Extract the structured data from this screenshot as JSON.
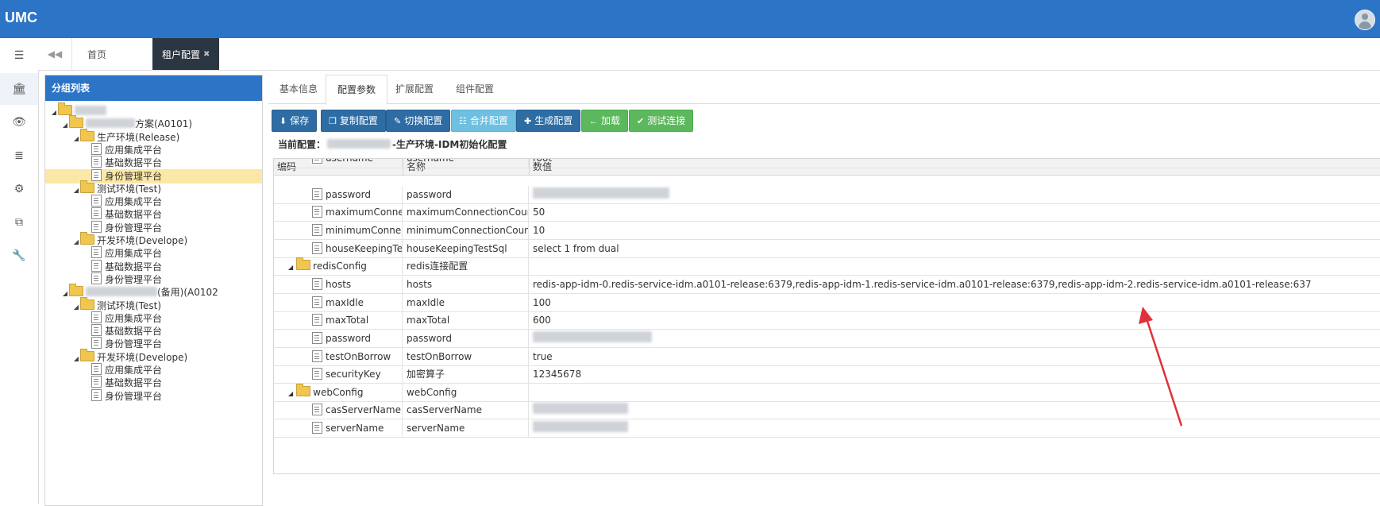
{
  "app": {
    "brand": "UMC"
  },
  "rail": {
    "items": [
      {
        "name": "rail-toggle-icon",
        "glyph": "☰"
      },
      {
        "name": "bank-icon",
        "glyph": "🏛"
      },
      {
        "name": "eye-icon",
        "glyph": "👁"
      },
      {
        "name": "list-icon",
        "glyph": "≣"
      },
      {
        "name": "gear-icon",
        "glyph": "⚙"
      },
      {
        "name": "sitemap-icon",
        "glyph": "⧉"
      },
      {
        "name": "wrench-icon",
        "glyph": "🔧"
      }
    ]
  },
  "tabstrip": {
    "nav_glyph": "◀◀",
    "home_label": "首页",
    "active_label": "租户配置",
    "close_glyph": "✖"
  },
  "group_panel": {
    "title": "分组列表",
    "tree": [
      {
        "depth": 0,
        "kind": "folder",
        "expanded": true,
        "label": "",
        "blurred": true,
        "blur_width": 40
      },
      {
        "depth": 1,
        "kind": "folder",
        "expanded": true,
        "label": "方案(A0101)",
        "blurred": true,
        "blur_width": 62
      },
      {
        "depth": 2,
        "kind": "folder",
        "expanded": true,
        "label": "生产环境(Release)"
      },
      {
        "depth": 3,
        "kind": "file",
        "label": "应用集成平台"
      },
      {
        "depth": 3,
        "kind": "file",
        "label": "基础数据平台"
      },
      {
        "depth": 3,
        "kind": "file",
        "label": "身份管理平台",
        "selected": true
      },
      {
        "depth": 2,
        "kind": "folder",
        "expanded": true,
        "label": "测试环境(Test)"
      },
      {
        "depth": 3,
        "kind": "file",
        "label": "应用集成平台"
      },
      {
        "depth": 3,
        "kind": "file",
        "label": "基础数据平台"
      },
      {
        "depth": 3,
        "kind": "file",
        "label": "身份管理平台"
      },
      {
        "depth": 2,
        "kind": "folder",
        "expanded": true,
        "label": "开发环境(Develope)"
      },
      {
        "depth": 3,
        "kind": "file",
        "label": "应用集成平台"
      },
      {
        "depth": 3,
        "kind": "file",
        "label": "基础数据平台"
      },
      {
        "depth": 3,
        "kind": "file",
        "label": "身份管理平台"
      },
      {
        "depth": 1,
        "kind": "folder",
        "expanded": true,
        "label": "(备用)(A0102",
        "blurred": true,
        "blur_width": 90
      },
      {
        "depth": 2,
        "kind": "folder",
        "expanded": true,
        "label": "测试环境(Test)"
      },
      {
        "depth": 3,
        "kind": "file",
        "label": "应用集成平台"
      },
      {
        "depth": 3,
        "kind": "file",
        "label": "基础数据平台"
      },
      {
        "depth": 3,
        "kind": "file",
        "label": "身份管理平台"
      },
      {
        "depth": 2,
        "kind": "folder",
        "expanded": true,
        "label": "开发环境(Develope)"
      },
      {
        "depth": 3,
        "kind": "file",
        "label": "应用集成平台"
      },
      {
        "depth": 3,
        "kind": "file",
        "label": "基础数据平台"
      },
      {
        "depth": 3,
        "kind": "file",
        "label": "身份管理平台"
      }
    ]
  },
  "content": {
    "tabs": [
      {
        "label": "基本信息",
        "active": false
      },
      {
        "label": "配置参数",
        "active": true
      },
      {
        "label": "扩展配置",
        "active": false
      },
      {
        "label": "组件配置",
        "active": false
      }
    ],
    "toolbar": [
      {
        "name": "save-button",
        "label": "保存",
        "icon": "⬇",
        "style": "blue"
      },
      {
        "name": "copy-config-button",
        "label": "复制配置",
        "icon": "❐",
        "style": "blue"
      },
      {
        "name": "switch-config-button",
        "label": "切换配置",
        "icon": "✎",
        "style": "blue"
      },
      {
        "name": "merge-config-button",
        "label": "合并配置",
        "icon": "☷",
        "style": "lightblue"
      },
      {
        "name": "generate-config-button",
        "label": "生成配置",
        "icon": "✚",
        "style": "blue"
      },
      {
        "name": "load-button",
        "label": "加载",
        "icon": "←",
        "style": "green"
      },
      {
        "name": "test-connection-button",
        "label": "测试连接",
        "icon": "✔",
        "style": "green"
      }
    ],
    "current_config": {
      "prefix": "当前配置：",
      "suffix": "-生产环境-IDM初始化配置"
    },
    "grid": {
      "columns": [
        "编码",
        "名称",
        "数值"
      ],
      "rows": [
        {
          "depth": 2,
          "kind": "file",
          "code": "username",
          "name": "username",
          "value": "root",
          "partial": true
        },
        {
          "depth": 2,
          "kind": "file",
          "code": "password",
          "name": "password",
          "value": "",
          "blurred_value_width": 172
        },
        {
          "depth": 2,
          "kind": "file",
          "code": "maximumConnect",
          "name": "maximumConnectionCount",
          "value": "50"
        },
        {
          "depth": 2,
          "kind": "file",
          "code": "minimumConnecti",
          "name": "minimumConnectionCount",
          "value": "10"
        },
        {
          "depth": 2,
          "kind": "file",
          "code": "houseKeepingTest",
          "name": "houseKeepingTestSql",
          "value": "select 1 from dual"
        },
        {
          "depth": 1,
          "kind": "folder",
          "code": "redisConfig",
          "name": "redis连接配置",
          "value": ""
        },
        {
          "depth": 2,
          "kind": "file",
          "code": "hosts",
          "name": "hosts",
          "value": "redis-app-idm-0.redis-service-idm.a0101-release:6379,redis-app-idm-1.redis-service-idm.a0101-release:6379,redis-app-idm-2.redis-service-idm.a0101-release:637"
        },
        {
          "depth": 2,
          "kind": "file",
          "code": "maxIdle",
          "name": "maxIdle",
          "value": "100"
        },
        {
          "depth": 2,
          "kind": "file",
          "code": "maxTotal",
          "name": "maxTotal",
          "value": "600"
        },
        {
          "depth": 2,
          "kind": "file",
          "code": "password",
          "name": "password",
          "value": "",
          "blurred_value_width": 150
        },
        {
          "depth": 2,
          "kind": "file",
          "code": "testOnBorrow",
          "name": "testOnBorrow",
          "value": "true"
        },
        {
          "depth": 2,
          "kind": "file",
          "code": "securityKey",
          "name": "加密算子",
          "value": "12345678"
        },
        {
          "depth": 1,
          "kind": "folder",
          "code": "webConfig",
          "name": "webConfig",
          "value": ""
        },
        {
          "depth": 2,
          "kind": "file",
          "code": "casServerName",
          "name": "casServerName",
          "value": "",
          "blurred_value_width": 120
        },
        {
          "depth": 2,
          "kind": "file",
          "code": "serverName",
          "name": "serverName",
          "value": "",
          "blurred_value_width": 120
        }
      ]
    }
  },
  "colors": {
    "topbar": "#2b74c6",
    "active_tab": "#2b3643",
    "tree_selected": "#fbe8a6",
    "annotation_arrow": "#e0303a"
  }
}
